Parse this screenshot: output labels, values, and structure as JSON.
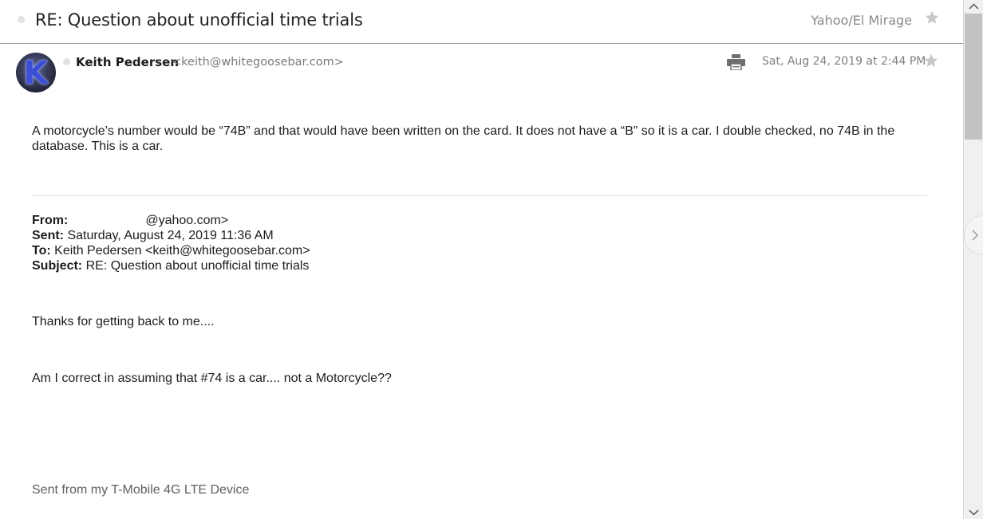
{
  "header": {
    "subject": "RE: Question about unofficial time trials",
    "folder": "Yahoo/El Mirage"
  },
  "message": {
    "sender_name": "Keith Pedersen",
    "sender_email": "<keith@whitegoosebar.com>",
    "date": "Sat, Aug 24, 2019 at 2:44 PM",
    "avatar_letter": "K",
    "body_paragraph": "A motorcycle’s number would be “74B” and that would have been written on the card.  It does not have a “B” so it is a car.  I double checked, no 74B in the database.  This is a car."
  },
  "quoted": {
    "from_label": "From:",
    "from_value": "@yahoo.com>",
    "sent_label": "Sent:",
    "sent_value": "Saturday, August 24, 2019 11:36 AM",
    "to_label": "To:",
    "to_value": "Keith Pedersen <keith@whitegoosebar.com>",
    "subject_label": "Subject:",
    "subject_value": "RE: Question about unofficial time trials",
    "line1": "Thanks for getting back to me....",
    "line2": "Am I correct in assuming that #74 is a car.... not a Motorcycle??",
    "signature": "Sent from my T-Mobile 4G LTE Device"
  },
  "icons": {
    "star": "star-icon",
    "print": "printer-icon",
    "next": "chevron-right-icon"
  },
  "colors": {
    "star": "#c8c8c8",
    "unread_dot": "#e1e1e1",
    "muted_text": "#8a8a8a"
  }
}
